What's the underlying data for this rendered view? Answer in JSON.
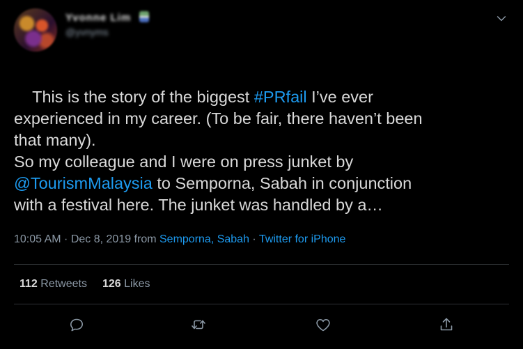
{
  "author": {
    "name": "Yvonne Lim",
    "handle": "@yvnyms"
  },
  "tweet": {
    "segments": [
      {
        "text": "This is the story of the biggest ",
        "link": false
      },
      {
        "text": "#PRfail",
        "link": true
      },
      {
        "text": " I’ve ever\nexperienced in my career. (To be fair, there haven’t been\nthat many).\nSo my colleague and I were on press junket by\n",
        "link": false
      },
      {
        "text": "@TourismMalaysia",
        "link": true
      },
      {
        "text": " to Semporna, Sabah in conjunction\nwith a festival here. The junket was handled by a…",
        "link": false
      }
    ]
  },
  "meta": {
    "time": "10:05 AM",
    "sep1": " · ",
    "date": "Dec 8, 2019",
    "from": " from ",
    "location": "Semporna, Sabah",
    "sep2": " · ",
    "source": "Twitter for iPhone"
  },
  "stats": {
    "retweets_count": "112",
    "retweets_label": "Retweets",
    "likes_count": "126",
    "likes_label": "Likes"
  },
  "icons": {
    "caret": "chevron-down-icon",
    "reply": "reply-icon",
    "retweet": "retweet-icon",
    "like": "heart-icon",
    "share": "share-icon"
  },
  "colors": {
    "background": "#000000",
    "text": "#d9d9d9",
    "muted": "#8b98a5",
    "link": "#1d9bf0"
  }
}
